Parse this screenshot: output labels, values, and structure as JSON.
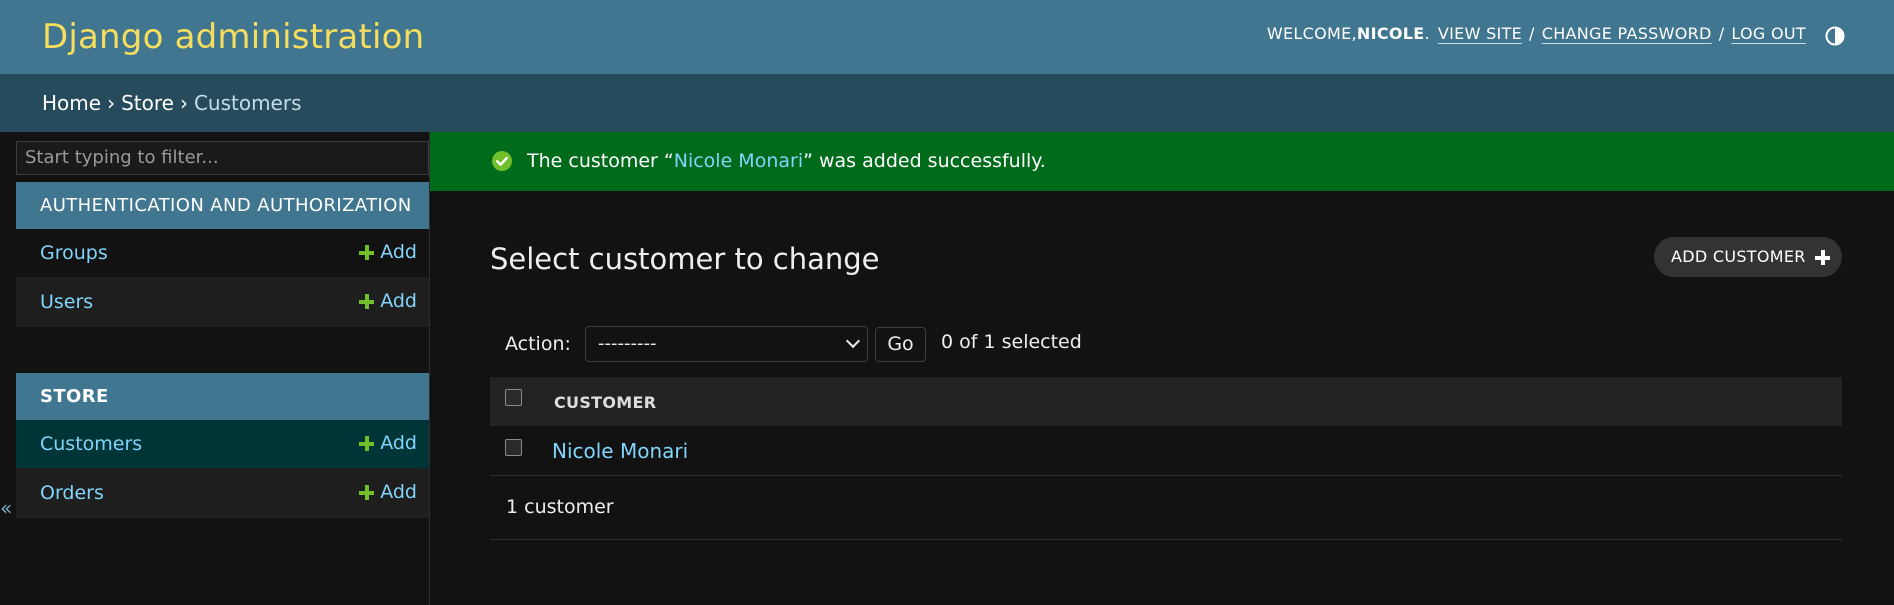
{
  "header": {
    "brand": "Django administration",
    "welcome_prefix": "WELCOME, ",
    "username": "NICOLE",
    "welcome_suffix": ".",
    "view_site": "VIEW SITE",
    "change_password": "CHANGE PASSWORD",
    "log_out": "LOG OUT",
    "separator": "/",
    "theme_toggle_icon": "contrast-icon"
  },
  "breadcrumbs": {
    "home": "Home",
    "store": "Store",
    "current": "Customers",
    "arrow": "›"
  },
  "sidebar": {
    "filter_placeholder": "Start typing to filter...",
    "toggle_glyph": "«",
    "add_label": "Add",
    "modules": [
      {
        "name": "AUTHENTICATION AND AUTHORIZATION",
        "models": [
          {
            "name": "Groups"
          },
          {
            "name": "Users"
          }
        ]
      },
      {
        "name": "STORE",
        "models": [
          {
            "name": "Customers",
            "current": true
          },
          {
            "name": "Orders"
          }
        ]
      }
    ]
  },
  "message": {
    "prefix": "The customer “",
    "link": "Nicole Monari",
    "suffix": "” was added successfully.",
    "icon": "success-check-icon"
  },
  "main": {
    "title": "Select customer to change",
    "add_button": "ADD CUSTOMER",
    "action_label": "Action:",
    "action_selected": "---------",
    "go_button": "Go",
    "selected_count": "0 of 1 selected",
    "column_header": "CUSTOMER",
    "rows": [
      {
        "name": "Nicole Monari"
      }
    ],
    "paginator": "1 customer"
  },
  "colors": {
    "header_bg": "#417690",
    "brand": "#f5dd5d",
    "breadcrumbs_bg": "#264b5d",
    "success_bg": "#006b1b",
    "link": "#81d4fa",
    "add_plus": "#70bf2b",
    "current_model_bg": "#003538"
  }
}
